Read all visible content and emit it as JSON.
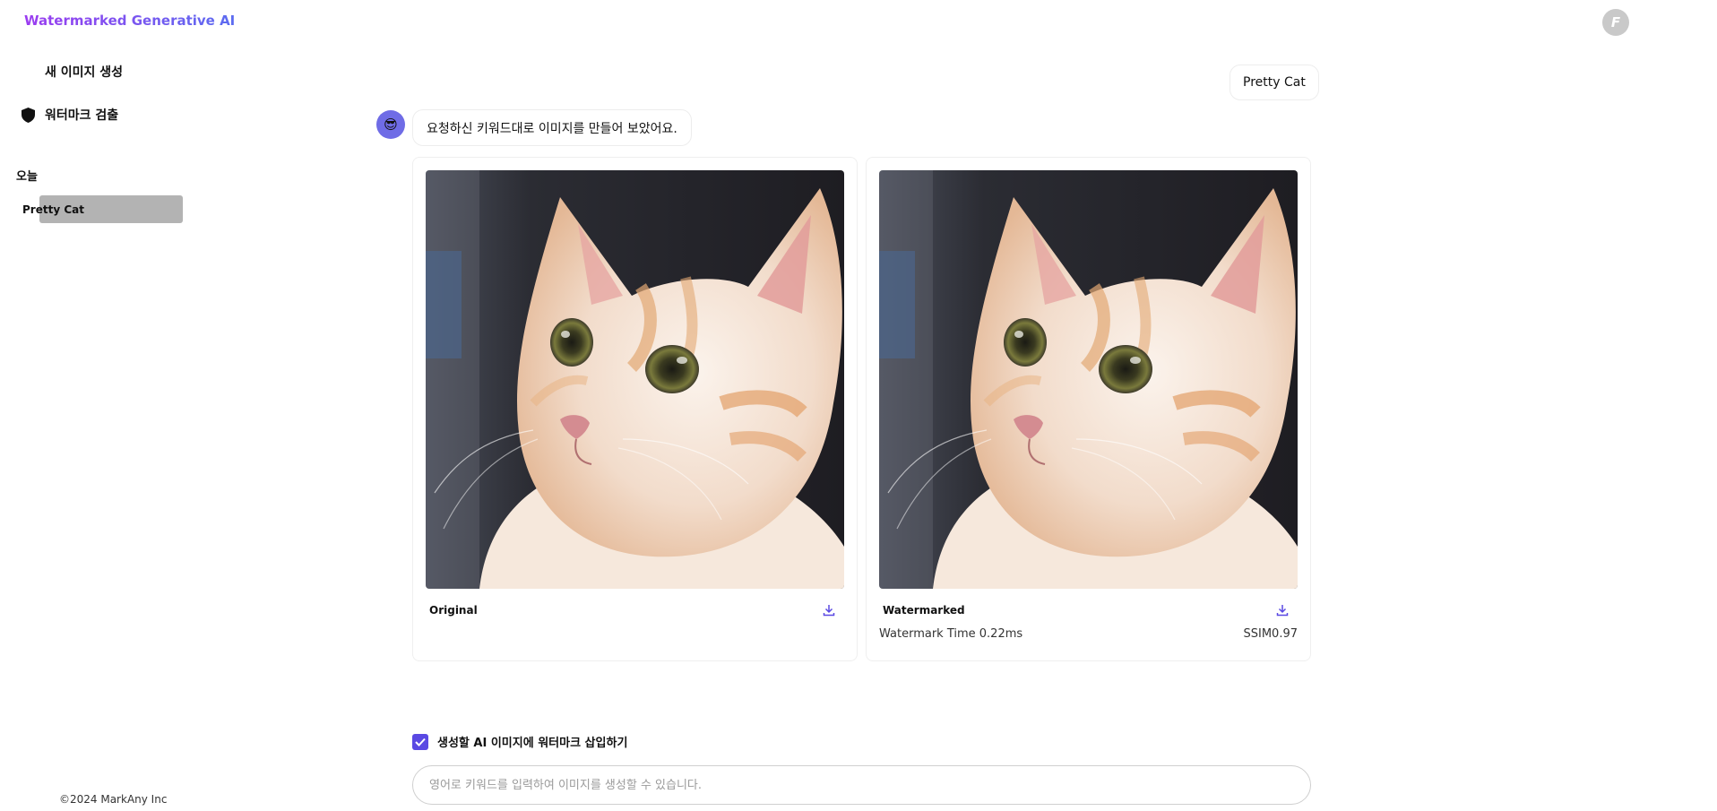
{
  "app": {
    "brand": "Watermarked Generative AI",
    "user_initial": "F"
  },
  "sidebar": {
    "new_image": "새 이미지 생성",
    "detect": "워터마크 검출",
    "section_today": "오늘",
    "history": [
      {
        "label": "Pretty Cat"
      }
    ],
    "footer": "©2024 MarkAny Inc"
  },
  "chat": {
    "user_message": "Pretty Cat",
    "bot_message": "요청하신 키워드대로 이미지를 만들어 보았어요.",
    "bot_avatar": "😎"
  },
  "results": {
    "original": {
      "title": "Original"
    },
    "watermarked": {
      "title": "Watermarked",
      "time_label": "Watermark Time 0.22ms",
      "ssim_label": "SSIM0.97"
    }
  },
  "composer": {
    "checkbox_label": "생성할 AI 이미지에 워터마크 삽입하기",
    "checked": true,
    "placeholder": "영어로 키워드를 입력하여 이미지를 생성할 수 있습니다."
  },
  "colors": {
    "accent": "#5a49e3",
    "brand_start": "#9b3cf0",
    "brand_end": "#5b6cf0"
  }
}
